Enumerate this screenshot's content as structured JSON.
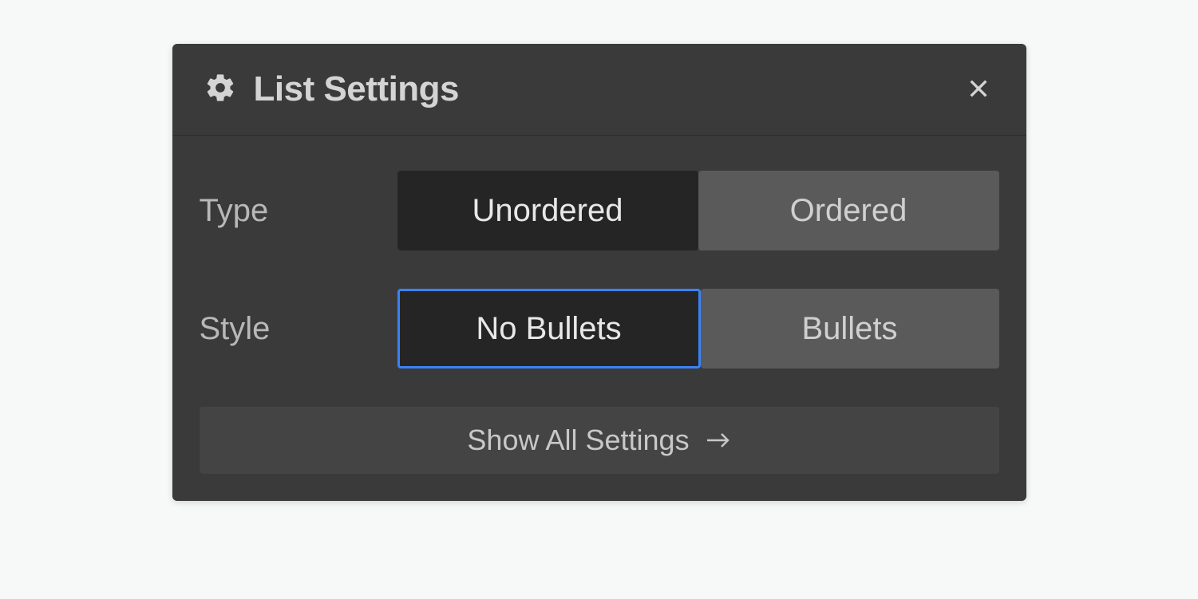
{
  "panel": {
    "title": "List Settings"
  },
  "settings": {
    "type": {
      "label": "Type",
      "options": {
        "unordered": "Unordered",
        "ordered": "Ordered"
      },
      "selected": "unordered"
    },
    "style": {
      "label": "Style",
      "options": {
        "no_bullets": "No Bullets",
        "bullets": "Bullets"
      },
      "selected": "no_bullets"
    }
  },
  "footer": {
    "show_all_label": "Show All Settings"
  },
  "icons": {
    "gear": "gear-icon",
    "close": "close-icon",
    "arrow_right": "arrow-right-icon"
  },
  "colors": {
    "panel_bg": "#3a3a3a",
    "selected_bg": "#252525",
    "unselected_bg": "#5a5a5a",
    "focus_border": "#3b82f6",
    "text_light": "#d4d4d4"
  }
}
